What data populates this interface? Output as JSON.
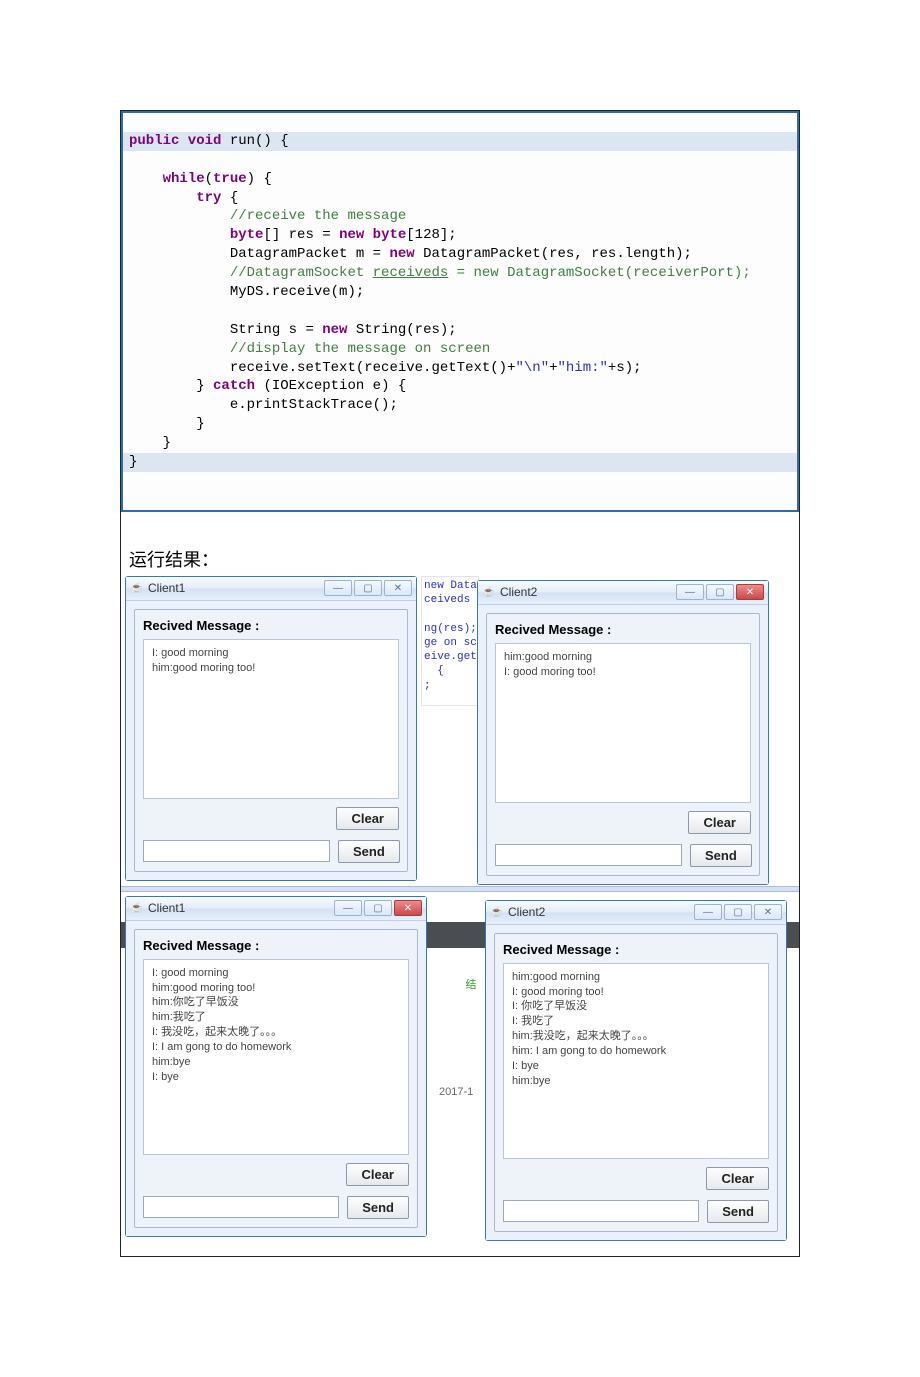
{
  "code": {
    "line1_pre": "public void",
    "line1_post": " run() {",
    "line2_pre": "while",
    "line2_post": "(",
    "line2_true": "true",
    "line2_end": ") {",
    "line3_pre": "try",
    "line3_post": " {",
    "c1": "//receive the message",
    "l4a": "byte",
    "l4b": "[] res = ",
    "l4c": "new byte",
    "l4d": "[128];",
    "l5a": "DatagramPacket m = ",
    "l5b": "new",
    "l5c": " DatagramPacket(res, res.length);",
    "c2": "//DatagramSocket ",
    "c2u": "receiveds",
    "c2b": " = new DatagramSocket(receiverPort);",
    "l6": "MyDS.receive(m);",
    "l7a": "String s = ",
    "l7b": "new",
    "l7c": " String(res);",
    "c3": "//display the message on screen",
    "l8a": "receive.setText(receive.getText()+",
    "l8s1": "\"\\n\"",
    "l8b": "+",
    "l8s2": "\"him:\"",
    "l8c": "+s);",
    "l9a": "} ",
    "l9b": "catch",
    "l9c": " (IOException e) {",
    "l10": "e.printStackTrace();",
    "l11": "}",
    "l12": "}",
    "l13": "}"
  },
  "section_label": "运行结果：",
  "bg_strip": "new Data\nceiveds\n\nng(res);\nge on sc\neive.get\n  {\n;",
  "bg_label2": "结",
  "bg_date": "2017-1",
  "client1_top": {
    "title": "Client1",
    "panel_label": "Recived Message :",
    "messages": "I: good morning\nhim:good moring too!",
    "clear": "Clear",
    "send": "Send"
  },
  "client2_top": {
    "title": "Client2",
    "panel_label": "Recived Message :",
    "messages": "him:good morning\nI: good moring too!",
    "clear": "Clear",
    "send": "Send"
  },
  "client1_bot": {
    "title": "Client1",
    "panel_label": "Recived Message :",
    "messages": "I: good morning\nhim:good moring too!\nhim:你吃了早饭没\nhim:我吃了\nI: 我没吃，起来太晚了。。。\nI: I am gong to do homework\nhim:bye\nI: bye",
    "clear": "Clear",
    "send": "Send"
  },
  "client2_bot": {
    "title": "Client2",
    "panel_label": "Recived Message :",
    "messages": "him:good morning\nI: good moring too!\nI: 你吃了早饭没\nI: 我吃了\nhim:我没吃，起来太晚了。。。\nhim: I am gong to do homework\nI: bye\nhim:bye",
    "clear": "Clear",
    "send": "Send"
  }
}
